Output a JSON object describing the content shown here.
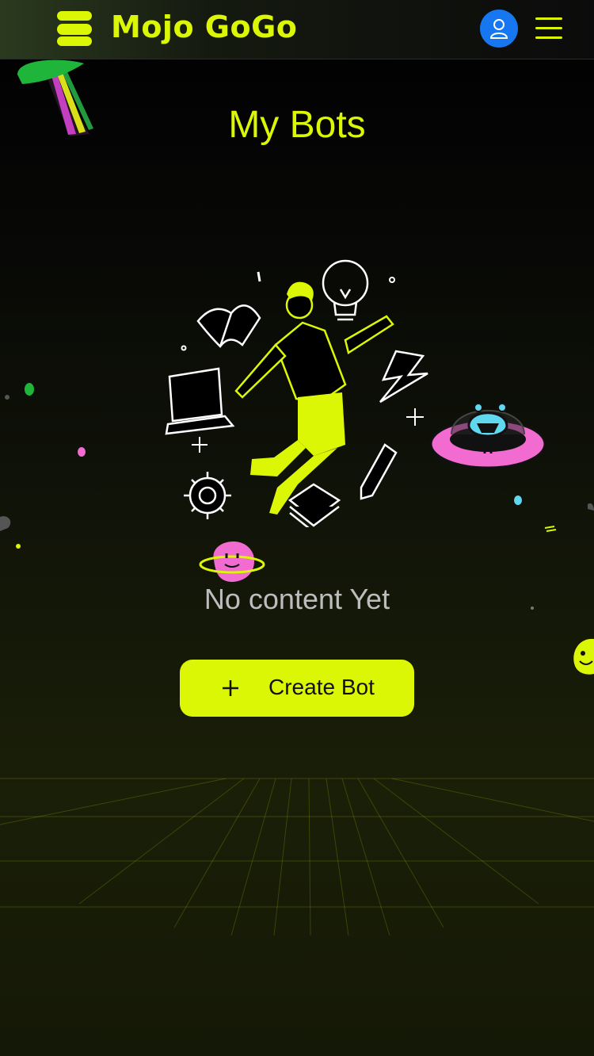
{
  "app": {
    "name": "Mojo GoGo"
  },
  "header": {
    "profile_icon": "user-icon",
    "menu_icon": "hamburger-icon"
  },
  "page": {
    "title": "My Bots"
  },
  "empty_state": {
    "message": "No content Yet",
    "illustration": "person-with-ideas-illustration"
  },
  "actions": {
    "create_bot_label": "Create Bot",
    "create_bot_icon": "plus-icon"
  },
  "colors": {
    "accent": "#dcf705",
    "profile": "#1777f0",
    "pink": "#f26bd0",
    "cyan": "#5fd8f0"
  }
}
